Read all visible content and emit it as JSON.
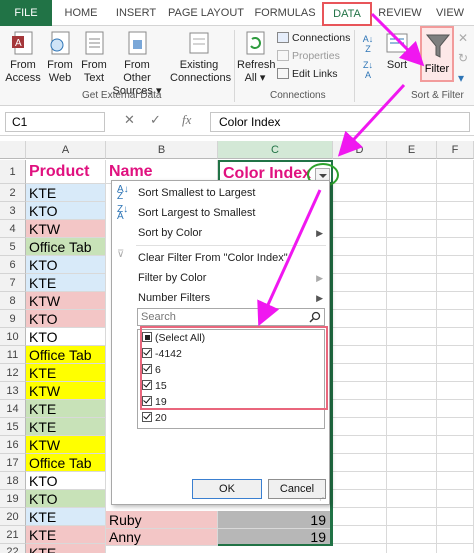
{
  "tabs": [
    "FILE",
    "HOME",
    "INSERT",
    "PAGE LAYOUT",
    "FORMULAS",
    "DATA",
    "REVIEW",
    "VIEW"
  ],
  "ribbon": {
    "from_access": [
      "From",
      "Access"
    ],
    "from_web": [
      "From",
      "Web"
    ],
    "from_text": [
      "From",
      "Text"
    ],
    "from_other": [
      "From Other",
      "Sources ▾"
    ],
    "existing": [
      "Existing",
      "Connections"
    ],
    "refresh": [
      "Refresh",
      "All ▾"
    ],
    "connections": "Connections",
    "properties": "Properties",
    "edit_links": "Edit Links",
    "sort": "Sort",
    "filter": "Filter",
    "group_external": "Get External Data",
    "group_connections": "Connections",
    "group_sort": "Sort & Filter"
  },
  "formula_bar": {
    "name_box": "C1",
    "cancel": "✕",
    "enter": "✓",
    "fx": "fx",
    "formula": "Color Index"
  },
  "columns": [
    "A",
    "B",
    "C",
    "D",
    "E",
    "F"
  ],
  "rows": [
    "1",
    "2",
    "3",
    "4",
    "5",
    "6",
    "7",
    "8",
    "9",
    "10",
    "11",
    "12",
    "13",
    "14",
    "15",
    "16",
    "17",
    "18",
    "19",
    "20",
    "21",
    "22"
  ],
  "headers": {
    "product": "Product",
    "name": "Name",
    "color_index": "Color Index"
  },
  "products": [
    "KTE",
    "KTO",
    "KTW",
    "Office Tab",
    "KTO",
    "KTE",
    "KTW",
    "KTO",
    "KTO",
    "Office Tab",
    "KTE",
    "KTW",
    "KTE",
    "KTE",
    "KTW",
    "Office Tab",
    "KTO",
    "KTO",
    "KTE",
    "KTE",
    "KTE"
  ],
  "product_colors": [
    "#d8eaf9",
    "#d8eaf9",
    "#f3c6c6",
    "#c8e2b8",
    "#d8eaf9",
    "#d8eaf9",
    "#f3c6c6",
    "#f3c6c6",
    "#ffffff",
    "#ffff00",
    "#ffff00",
    "#ffff00",
    "#c8e2b8",
    "#c8e2b8",
    "#ffff00",
    "#ffff00",
    "#ffffff",
    "#c8e2b8",
    "#d8eaf9",
    "#f3c6c6",
    "#f3c6c6"
  ],
  "b_visible": {
    "r21": "Ruby",
    "r22": "Anny",
    "c21": "19",
    "c22": "19"
  },
  "filter_menu": {
    "sort_asc": "Sort Smallest to Largest",
    "sort_desc": "Sort Largest to Smallest",
    "sort_color": "Sort by Color",
    "clear_filter": "Clear Filter From \"Color Index\"",
    "filter_color": "Filter by Color",
    "number_filters": "Number Filters",
    "search_placeholder": "Search",
    "items": [
      "(Select All)",
      "-4142",
      "6",
      "15",
      "19",
      "20"
    ],
    "checked": [
      false,
      true,
      true,
      true,
      true,
      true
    ],
    "ok": "OK",
    "cancel": "Cancel"
  },
  "colors": {
    "accent_green": "#217346",
    "header_text": "#e0117f",
    "arrow_magenta": "#f017f0",
    "highlight_red": "#e8555a",
    "circle_green": "#2ca32c"
  }
}
